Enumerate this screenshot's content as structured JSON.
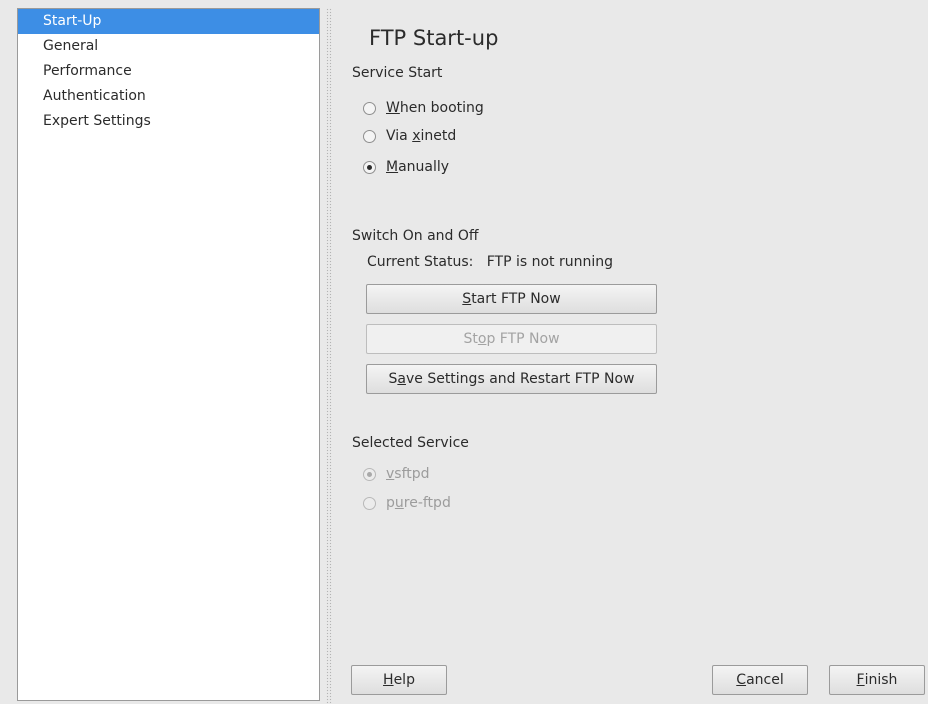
{
  "sidebar": {
    "items": [
      {
        "label": "Start-Up",
        "selected": true
      },
      {
        "label": "General"
      },
      {
        "label": "Performance"
      },
      {
        "label": "Authentication"
      },
      {
        "label": "Expert Settings"
      }
    ]
  },
  "page": {
    "title": "FTP Start-up"
  },
  "service_start": {
    "label": "Service Start",
    "options": [
      {
        "pre": "",
        "key": "W",
        "post": "hen booting",
        "checked": false
      },
      {
        "pre": "Via ",
        "key": "x",
        "post": "inetd",
        "checked": false
      },
      {
        "pre": "",
        "key": "M",
        "post": "anually",
        "checked": true
      }
    ]
  },
  "switch": {
    "label": "Switch On and Off",
    "status_label": "Current Status:",
    "status_value": "FTP is not running",
    "start_btn": {
      "pre": "",
      "key": "S",
      "post": "tart FTP Now"
    },
    "stop_btn": {
      "pre": "St",
      "key": "o",
      "post": "p FTP Now"
    },
    "save_btn": {
      "pre": "S",
      "key": "a",
      "post": "ve Settings and Restart FTP Now"
    }
  },
  "selected_service": {
    "label": "Selected Service",
    "options": [
      {
        "pre": "",
        "key": "v",
        "post": "sftpd",
        "checked": true
      },
      {
        "pre": "p",
        "key": "u",
        "post": "re-ftpd",
        "checked": false
      }
    ]
  },
  "footer": {
    "help": {
      "pre": "",
      "key": "H",
      "post": "elp"
    },
    "cancel": {
      "pre": "",
      "key": "C",
      "post": "ancel"
    },
    "finish": {
      "pre": "",
      "key": "F",
      "post": "inish"
    }
  },
  "colors": {
    "selection": "#3d8ee5",
    "background": "#e9e9e9"
  }
}
